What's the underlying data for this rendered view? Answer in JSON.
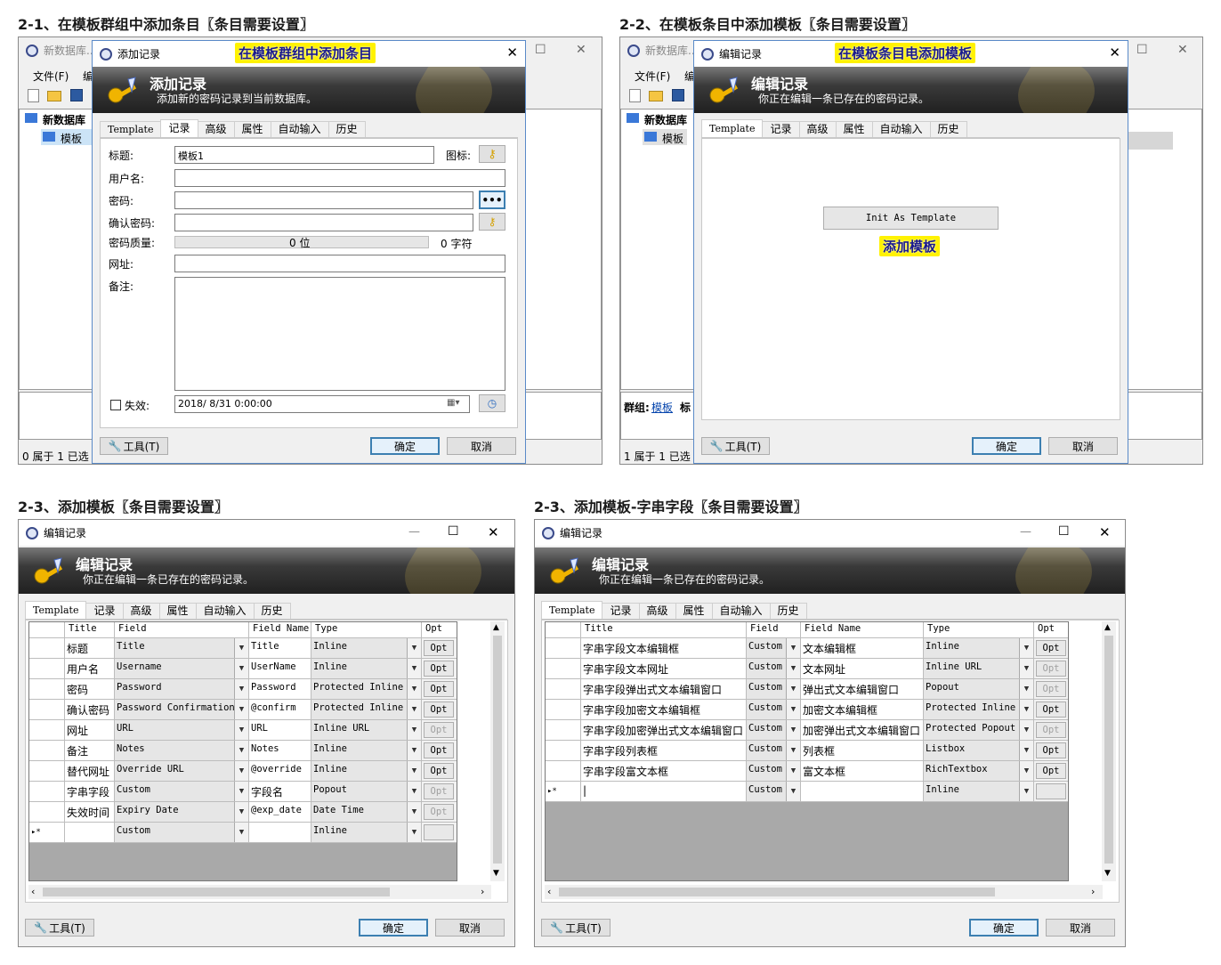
{
  "headings": {
    "h1": "2-1、在模板群组中添加条目〖条目需要设置〗",
    "h2": "2-2、在模板条目中添加模板〖条目需要设置〗",
    "h3": "2-3、添加模板〖条目需要设置〗",
    "h4": "2-3、添加模板-字串字段〖条目需要设置〗"
  },
  "annotations": {
    "a1": "在模板群组中添加条目",
    "a2": "在模板条目电添加模板",
    "a3": "添加模板"
  },
  "main_window": {
    "title": "新数据库...",
    "menu_file": "文件(F)",
    "menu_edit": "编",
    "tree_root": "新数据库",
    "tree_child": "模板",
    "status": "0 属于 1 已选",
    "status2": "1 属于 1 已选",
    "group_label": "群组:",
    "group_link": "模板",
    "group_more": "标",
    "title_buttons": {
      "min": "—",
      "max": "☐",
      "close": "✕"
    }
  },
  "tabs": [
    "Template",
    "记录",
    "高级",
    "属性",
    "自动输入",
    "历史"
  ],
  "dialog_add": {
    "title": "添加记录",
    "banner_title": "添加记录",
    "banner_sub": "添加新的密码记录到当前数据库。",
    "labels": {
      "title": "标题:",
      "icon": "图标:",
      "username": "用户名:",
      "password": "密码:",
      "confirm": "确认密码:",
      "quality": "密码质量:",
      "url": "网址:",
      "notes": "备注:",
      "expires": "失效:"
    },
    "title_value": "模板1",
    "quality_bits": "0 位",
    "quality_chars": "0 字符",
    "expiry_value": "2018/ 8/31   0:00:00",
    "dots": "•••"
  },
  "dialog_edit": {
    "title": "编辑记录",
    "banner_title": "编辑记录",
    "banner_sub": "你正在编辑一条已存在的密码记录。",
    "init_button": "Init As Template"
  },
  "buttons": {
    "tools": "工具(T)",
    "ok": "确定",
    "cancel": "取消"
  },
  "grid1": {
    "columns": [
      "Title",
      "Field",
      "Field Name",
      "Type",
      "Opt"
    ],
    "rows": [
      {
        "title": "标题",
        "field": "Title",
        "name": "Title",
        "type": "Inline",
        "opt": "Opt",
        "opt_enabled": true
      },
      {
        "title": "用户名",
        "field": "Username",
        "name": "UserName",
        "type": "Inline",
        "opt": "Opt",
        "opt_enabled": true
      },
      {
        "title": "密码",
        "field": "Password",
        "name": "Password",
        "type": "Protected Inline",
        "opt": "Opt",
        "opt_enabled": true
      },
      {
        "title": "确认密码",
        "field": "Password Confirmation",
        "name": "@confirm",
        "type": "Protected Inline",
        "opt": "Opt",
        "opt_enabled": true
      },
      {
        "title": "网址",
        "field": "URL",
        "name": "URL",
        "type": "Inline URL",
        "opt": "Opt",
        "opt_enabled": false
      },
      {
        "title": "备注",
        "field": "Notes",
        "name": "Notes",
        "type": "Inline",
        "opt": "Opt",
        "opt_enabled": true
      },
      {
        "title": "替代网址",
        "field": "Override URL",
        "name": "@override",
        "type": "Inline",
        "opt": "Opt",
        "opt_enabled": true
      },
      {
        "title": "字串字段",
        "field": "Custom",
        "name": "字段名",
        "type": "Popout",
        "opt": "Opt",
        "opt_enabled": false
      },
      {
        "title": "失效时间",
        "field": "Expiry Date",
        "name": "@exp_date",
        "type": "Date Time",
        "opt": "Opt",
        "opt_enabled": false
      }
    ],
    "new_row": {
      "marker": "▸*",
      "field": "Custom",
      "type": "Inline"
    }
  },
  "grid2": {
    "columns": [
      "Title",
      "Field",
      "Field Name",
      "Type",
      "Opt"
    ],
    "rows": [
      {
        "title": "字串字段文本编辑框",
        "field": "Custom",
        "name": "文本编辑框",
        "type": "Inline",
        "opt": "Opt",
        "opt_enabled": true
      },
      {
        "title": "字串字段文本网址",
        "field": "Custom",
        "name": "文本网址",
        "type": "Inline URL",
        "opt": "Opt",
        "opt_enabled": false
      },
      {
        "title": "字串字段弹出式文本编辑窗口",
        "field": "Custom",
        "name": "弹出式文本编辑窗口",
        "type": "Popout",
        "opt": "Opt",
        "opt_enabled": false
      },
      {
        "title": "字串字段加密文本编辑框",
        "field": "Custom",
        "name": "加密文本编辑框",
        "type": "Protected Inline",
        "opt": "Opt",
        "opt_enabled": true
      },
      {
        "title": "字串字段加密弹出式文本编辑窗口",
        "field": "Custom",
        "name": "加密弹出式文本编辑窗口",
        "type": "Protected Popout",
        "opt": "Opt",
        "opt_enabled": false
      },
      {
        "title": "字串字段列表框",
        "field": "Custom",
        "name": "列表框",
        "type": "Listbox",
        "opt": "Opt",
        "opt_enabled": true
      },
      {
        "title": "字串字段富文本框",
        "field": "Custom",
        "name": "富文本框",
        "type": "RichTextbox",
        "opt": "Opt",
        "opt_enabled": true
      }
    ],
    "new_row": {
      "marker": "▸*",
      "field": "Custom",
      "type": "Inline"
    }
  }
}
